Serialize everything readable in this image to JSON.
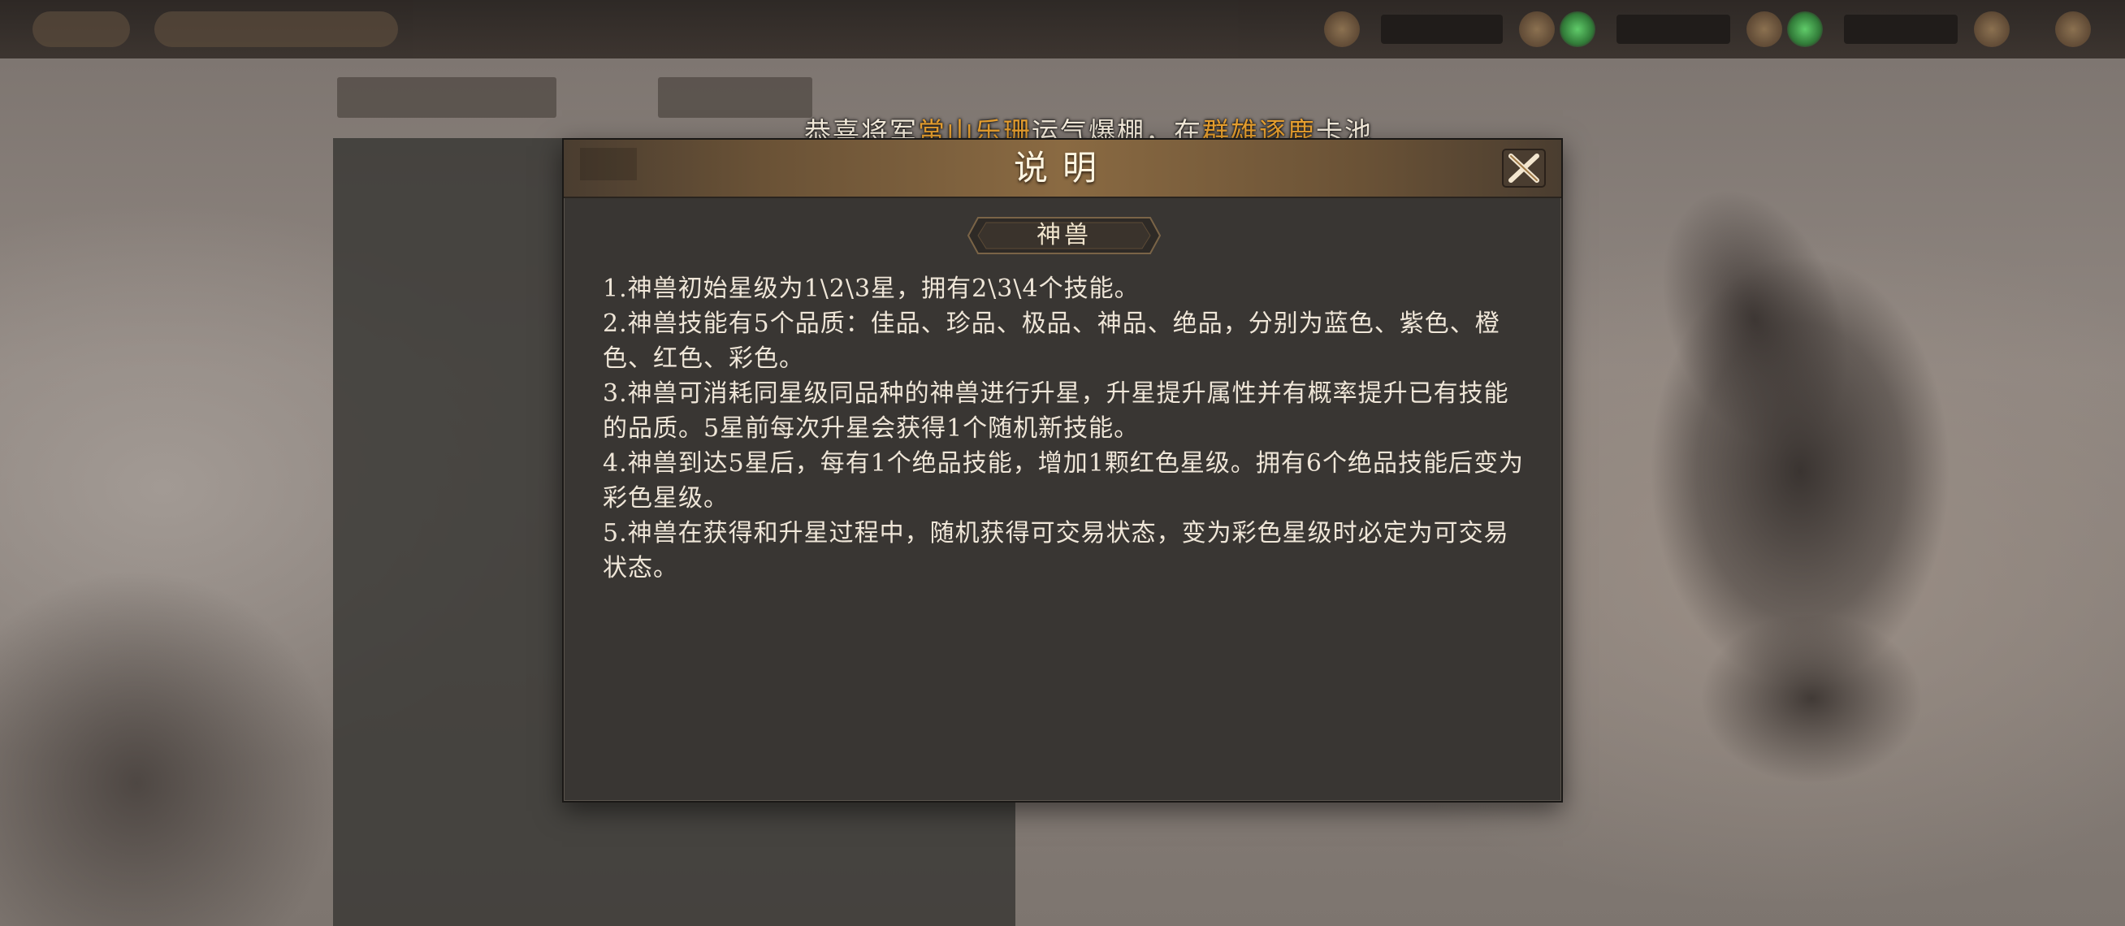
{
  "broadcast": {
    "prefix": "恭喜将军",
    "player_name": "常山乐珊",
    "middle": "运气爆棚，在",
    "event_name": "群雄逐鹿",
    "suffix": "卡池",
    "highlight_color": "#e8a030"
  },
  "dialog": {
    "title": "说明",
    "close_icon": "close-x-icon",
    "section_label": "神兽",
    "lines": [
      "1.神兽初始星级为1\\2\\3星，拥有2\\3\\4个技能。",
      "2.神兽技能有5个品质：佳品、珍品、极品、神品、绝品，分别为蓝色、紫色、橙色、红色、彩色。",
      "3.神兽可消耗同星级同品种的神兽进行升星，升星提升属性并有概率提升已有技能的品质。5星前每次升星会获得1个随机新技能。",
      "4.神兽到达5星后，每有1个绝品技能，增加1颗红色星级。拥有6个绝品技能后变为彩色星级。",
      "5.神兽在获得和升星过程中，随机获得可交易状态，变为彩色星级时必定为可交易状态。"
    ]
  },
  "colors": {
    "panel_bg": "#393633",
    "header_gold": "#8a6a42",
    "text": "#efe6d8"
  }
}
